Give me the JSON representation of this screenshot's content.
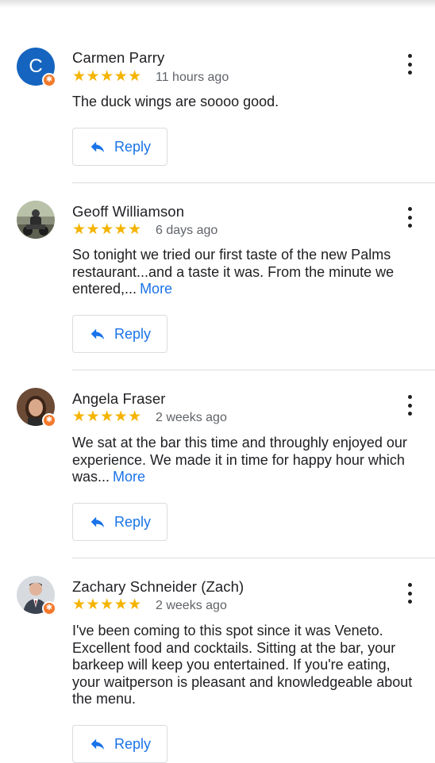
{
  "reviews": [
    {
      "name": "Carmen Parry",
      "initial": "C",
      "stars": "★★★★★",
      "time": "11 hours ago",
      "text": "The duck wings are soooo good.",
      "more": "",
      "reply_label": "Reply"
    },
    {
      "name": "Geoff Williamson",
      "stars": "★★★★★",
      "time": "6 days ago",
      "text": "So tonight we tried our first taste of the new Palms restaurant...and a taste it was. From the minute we entered,...",
      "more": "More",
      "reply_label": "Reply"
    },
    {
      "name": "Angela Fraser",
      "stars": "★★★★★",
      "time": "2 weeks ago",
      "text": "We sat at the bar this time and throughly enjoyed our experience. We made it in time for happy hour which was...",
      "more": "More",
      "reply_label": "Reply"
    },
    {
      "name": "Zachary Schneider (Zach)",
      "stars": "★★★★★",
      "time": "2 weeks ago",
      "text": "I've been coming to this spot since it was Veneto. Excellent food and cocktails. Sitting at the bar, your barkeep will keep you entertained. If you're eating, your waitperson is pleasant and knowledgeable about the menu.",
      "more": "",
      "reply_label": "Reply"
    }
  ],
  "colors": {
    "star": "#f4b400",
    "link": "#1a73e8",
    "badge": "#f4792b",
    "avatar_letter_bg": "#1565c0"
  }
}
